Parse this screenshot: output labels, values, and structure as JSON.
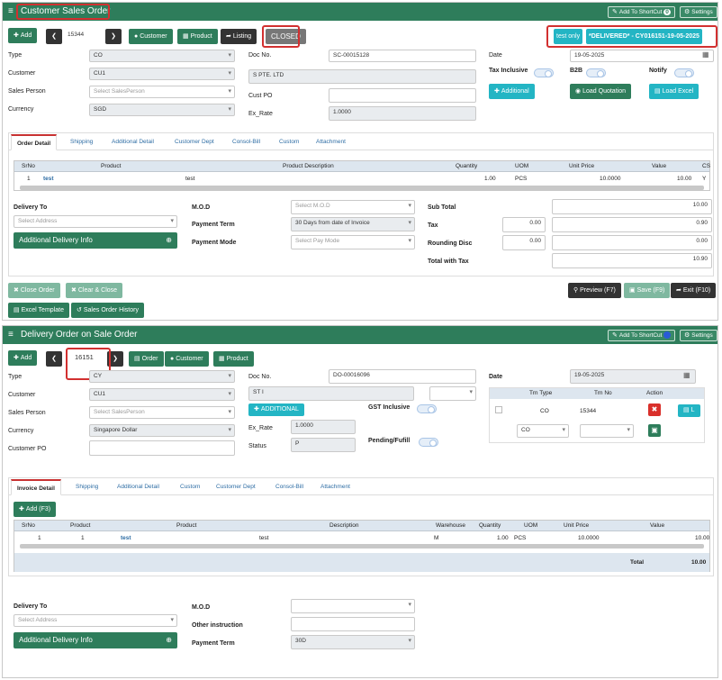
{
  "so": {
    "title": "Customer Sales Order",
    "header_buttons": {
      "shortcut": "Add To ShortCut",
      "shortcut_badge": "0",
      "settings": "Settings"
    },
    "toolbar": {
      "add": "Add",
      "number": "15344",
      "customer": "Customer",
      "product": "Product",
      "listing": "Listing",
      "status": "CLOSED"
    },
    "tags": {
      "test_only": "test only",
      "delivered": "*DELIVERED* - CY016151-19-05-2025"
    },
    "fields": {
      "type_label": "Type",
      "type_value": "CO",
      "customer_label": "Customer",
      "customer_value": "CU1",
      "sales_person_label": "Sales Person",
      "sales_person_placeholder": "Select SalesPerson",
      "currency_label": "Currency",
      "currency_value": "SGD",
      "doc_no_label": "Doc No.",
      "doc_no_value": "SC-00015128",
      "customer_name": "S PTE. LTD",
      "cust_po_label": "Cust PO",
      "cust_po_value": "",
      "ex_rate_label": "Ex_Rate",
      "ex_rate_value": "1.0000",
      "date_label": "Date",
      "date_value": "19-05-2025",
      "tax_inclusive_label": "Tax Inclusive",
      "b2b_label": "B2B",
      "notify_label": "Notify"
    },
    "action_buttons": {
      "additional": "Additional",
      "load_quotation": "Load Quotation",
      "load_excel": "Load Excel"
    },
    "tabs": [
      "Order Detail",
      "Shipping",
      "Additional Detail",
      "Customer Dept",
      "Consol-Bill",
      "Custom",
      "Attachment"
    ],
    "grid": {
      "headers": [
        "SrNo",
        "Product",
        "Product Description",
        "Quantity",
        "UOM",
        "Unit Price",
        "Value",
        "CS"
      ],
      "rows": [
        {
          "srno": "1",
          "product": "test",
          "description": "test",
          "quantity": "1.00",
          "uom": "PCS",
          "unit_price": "10.0000",
          "value": "10.00",
          "cs": "Y"
        }
      ]
    },
    "delivery": {
      "delivery_to_label": "Delivery To",
      "select_address": "Select Address",
      "additional_info": "Additional Delivery Info",
      "mod_label": "M.O.D",
      "mod_placeholder": "Select M.O.D",
      "payment_term_label": "Payment Term",
      "payment_term_value": "30 Days from date of Invoice",
      "payment_mode_label": "Payment Mode",
      "payment_mode_placeholder": "Select Pay Mode"
    },
    "totals": {
      "sub_total_label": "Sub Total",
      "sub_total_value": "10.00",
      "tax_label": "Tax",
      "tax_rate": "0.00",
      "tax_value": "0.90",
      "rounding_label": "Rounding Disc",
      "rounding_rate": "0.00",
      "rounding_value": "0.00",
      "total_with_tax_label": "Total with Tax",
      "total_with_tax_value": "10.90"
    },
    "bottom_buttons": {
      "close_order": "Close Order",
      "clear_close": "Clear & Close",
      "preview": "Preview (F7)",
      "save": "Save (F9)",
      "exit": "Exit (F10)",
      "excel_template": "Excel Template",
      "history": "Sales Order History"
    }
  },
  "do": {
    "title": "Delivery Order on Sale Order",
    "header_buttons": {
      "shortcut": "Add To ShortCut",
      "settings": "Settings"
    },
    "toolbar": {
      "add": "Add",
      "number": "16151",
      "order": "Order",
      "customer": "Customer",
      "product": "Product"
    },
    "fields": {
      "type_label": "Type",
      "type_value": "CY",
      "customer_label": "Customer",
      "customer_value": "CU1",
      "sales_person_label": "Sales Person",
      "sales_person_placeholder": "Select SalesPerson",
      "currency_label": "Currency",
      "currency_value": "Singapore Dollar",
      "customer_po_label": "Customer PO",
      "customer_po_value": "",
      "doc_no_label": "Doc No.",
      "doc_no_value": "DO-00016096",
      "customer_name": "ST I",
      "additional": "ADDITIONAL",
      "ex_rate_label": "Ex_Rate",
      "ex_rate_value": "1.0000",
      "status_label": "Status",
      "status_value": "P",
      "gst_inclusive_label": "GST Inclusive",
      "pending_label": "Pending/Fufill",
      "date_label": "Date",
      "date_value": "19-05-2025"
    },
    "trn_table": {
      "headers": [
        "Trn Type",
        "Trn No",
        "Action"
      ],
      "rows": [
        {
          "trn_type": "CO",
          "trn_no": "15344"
        }
      ],
      "new_row_type": "CO",
      "side_button": "L"
    },
    "tabs": [
      "Invoice Detail",
      "Shipping",
      "Additional Detail",
      "Custom",
      "Customer Dept",
      "Consol-Bill",
      "Attachment"
    ],
    "add_button": "Add (F3)",
    "grid": {
      "headers": [
        "SrNo",
        "Product",
        "Product",
        "Description",
        "Warehouse",
        "Quantity",
        "UOM",
        "Unit Price",
        "Value"
      ],
      "rows": [
        {
          "srno": "1",
          "product_no": "1",
          "product": "test",
          "description": "test",
          "warehouse": "M",
          "quantity": "1.00",
          "uom": "PCS",
          "unit_price": "10.0000",
          "value": "10.00"
        }
      ],
      "total_label": "Total",
      "total_value": "10.00"
    },
    "delivery": {
      "delivery_to_label": "Delivery To",
      "select_address": "Select Address",
      "additional_info": "Additional Delivery Info",
      "mod_label": "M.O.D",
      "mod_value": "",
      "other_label": "Other instruction",
      "other_value": "",
      "payment_term_label": "Payment Term",
      "payment_term_value": "30D"
    }
  },
  "colors": {
    "header_green": "#2e7d5b",
    "teal": "#23b5c4",
    "dark": "#333333",
    "highlight_red": "#d23030",
    "delete_red": "#d9302b"
  }
}
